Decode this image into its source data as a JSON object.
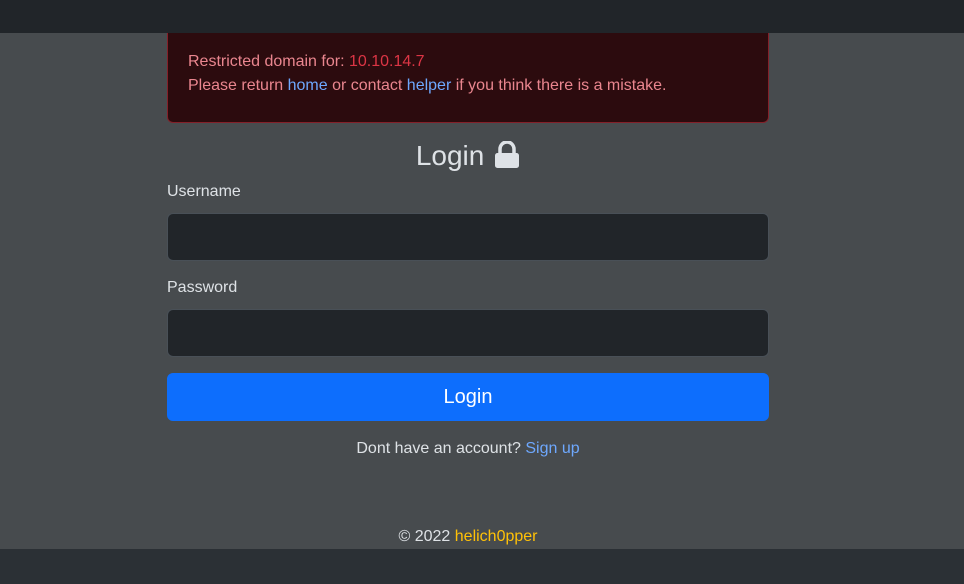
{
  "alert": {
    "restricted_label": "Restricted domain for: ",
    "ip": "10.10.14.7",
    "please_return": "Please return ",
    "home_link": "home",
    "or_contact": " or contact ",
    "helper_link": "helper",
    "mistake": " if you think there is a mistake."
  },
  "login": {
    "title": "Login",
    "title_icon": "lock-icon",
    "username_label": "Username",
    "username_value": "",
    "password_label": "Password",
    "password_value": "",
    "button_label": "Login"
  },
  "signup": {
    "prompt": "Dont have an account? ",
    "link": "Sign up"
  },
  "footer": {
    "copyright": "© 2022 ",
    "brand": "helich0pper"
  },
  "colors": {
    "accent": "#0d6efd",
    "link": "#6ea8fe",
    "alert_bg": "#2c0b0e",
    "ip": "#dc3545",
    "brand": "#ffc107"
  }
}
